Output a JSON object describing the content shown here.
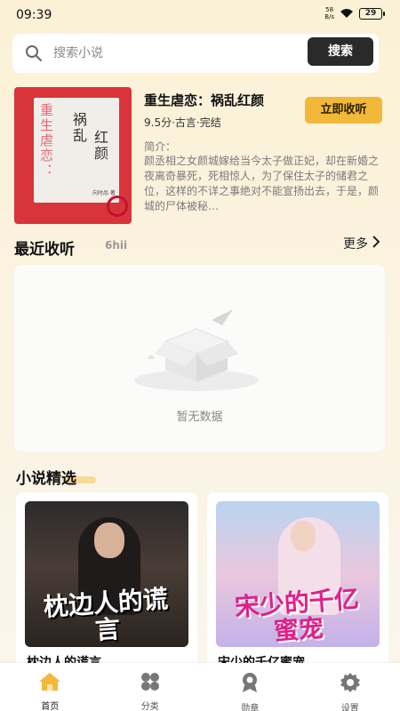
{
  "status": {
    "time": "09:39",
    "net_speed": "58\nB/s",
    "battery": "29"
  },
  "search": {
    "placeholder": "搜索小说",
    "button": "搜索"
  },
  "featured": {
    "title": "重生虐恋：祸乱红颜",
    "meta": "9.5分·古言·完结",
    "collect_button": "立即收听",
    "intro_label": "简介：",
    "intro": "颜丞相之女颜城嫁给当今太子做正妃，却在新婚之夜离奇暴死，死相惊人，为了保住太子的储君之位，这样的不详之事绝对不能宣扬出去，于是，颜城的尸体被秘…",
    "cover": {
      "text_a": "重生虐恋：",
      "text_b": "祸乱",
      "text_c": "红颜",
      "author": "向时品 著"
    }
  },
  "recent": {
    "title": "最近收听",
    "subtitle": "6hii",
    "more": "更多",
    "empty_text": "暂无数据"
  },
  "picks": {
    "title": "小说精选",
    "books": [
      {
        "cover_title": "枕边人的谎言",
        "name": "枕边人的谎言"
      },
      {
        "cover_title": "宋少的千亿蜜宠",
        "name": "宋少的千亿蜜宠"
      }
    ]
  },
  "tabs": [
    {
      "label": "首页",
      "icon": "home-icon",
      "active": true
    },
    {
      "label": "分类",
      "icon": "category-icon",
      "active": false
    },
    {
      "label": "勋章",
      "icon": "medal-icon",
      "active": false
    },
    {
      "label": "设置",
      "icon": "settings-icon",
      "active": false
    }
  ],
  "colors": {
    "accent": "#f2b83a",
    "home_active": "#f2b83a",
    "dark_button": "#2a2a2a"
  }
}
